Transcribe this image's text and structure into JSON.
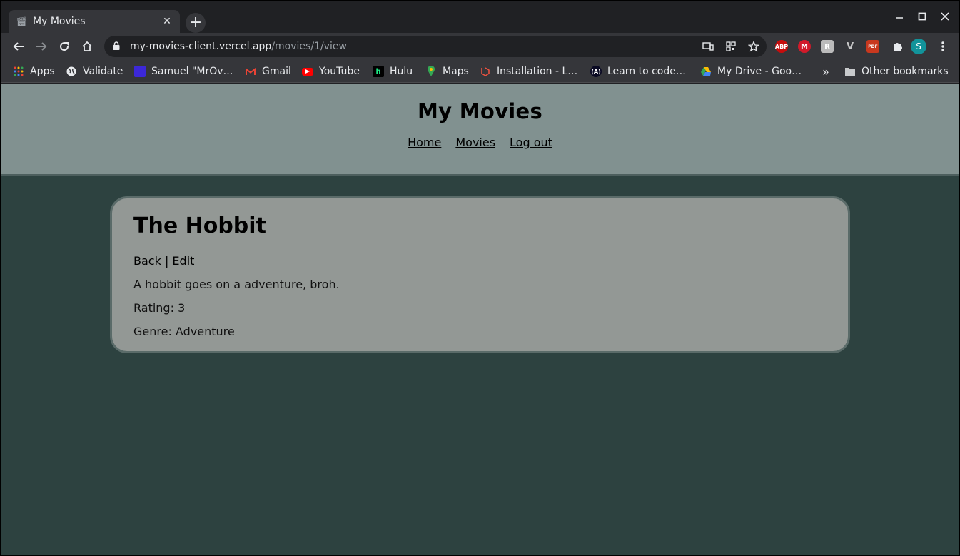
{
  "browser": {
    "tab_title": "My Movies",
    "tab_close_glyph": "✕",
    "new_tab_glyph": "+",
    "url_host": "my-movies-client.vercel.app",
    "url_path": "/movies/1/view",
    "profile_initial": "S",
    "extensions": [
      {
        "name": "ABP",
        "color": "#c70d0d"
      },
      {
        "name": "M",
        "color": "#d11a2a"
      },
      {
        "name": "R",
        "color": "#bbbbbb"
      },
      {
        "name": "V",
        "color": "#35363a"
      },
      {
        "name": "PDF",
        "color": "#c8381e"
      }
    ]
  },
  "bookmarks": {
    "items": [
      {
        "label": "Apps",
        "icon": "apps-grid-icon"
      },
      {
        "label": "Validate",
        "icon": "globe-icon"
      },
      {
        "label": "Samuel \"MrOv…",
        "icon": "bookmark-icon"
      },
      {
        "label": "Gmail",
        "icon": "gmail-icon"
      },
      {
        "label": "YouTube",
        "icon": "youtube-icon"
      },
      {
        "label": "Hulu",
        "icon": "hulu-icon"
      },
      {
        "label": "Maps",
        "icon": "maps-icon"
      },
      {
        "label": "Installation - L…",
        "icon": "laravel-icon"
      },
      {
        "label": "Learn to code…",
        "icon": "freecodecamp-icon"
      },
      {
        "label": "My Drive - Goo…",
        "icon": "drive-icon"
      }
    ],
    "overflow": "»",
    "other": "Other bookmarks"
  },
  "site": {
    "title": "My Movies",
    "nav": [
      "Home",
      "Movies",
      "Log out"
    ]
  },
  "movie": {
    "title": "The Hobbit",
    "back_label": "Back",
    "separator": "|",
    "edit_label": "Edit",
    "description": "A hobbit goes on a adventure, broh.",
    "rating": "Rating: 3",
    "genre": "Genre: Adventure"
  }
}
